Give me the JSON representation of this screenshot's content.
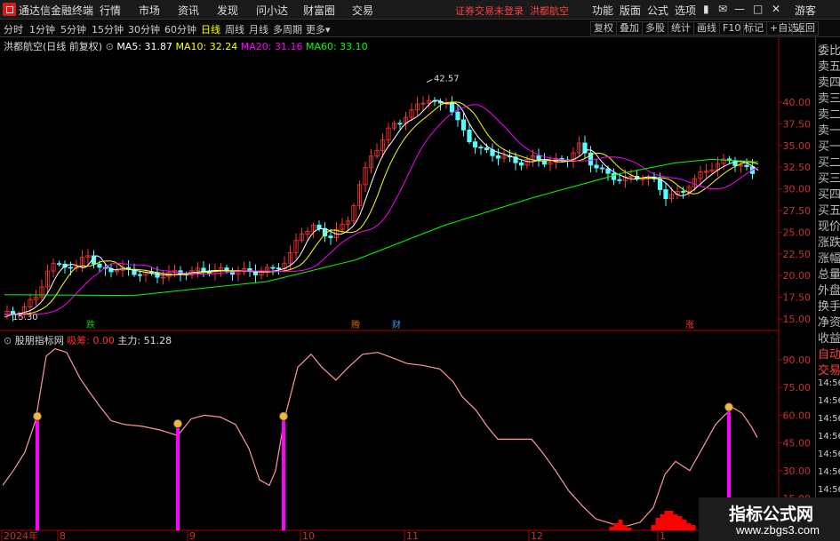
{
  "menubar": {
    "app_title": "通达信金融终端",
    "items": [
      "行情",
      "市场",
      "资讯",
      "发现",
      "问小达",
      "财富圈",
      "交易"
    ],
    "notice": "证券交易未登录",
    "stock": "洪都航空",
    "right_items": [
      "功能",
      "版面",
      "公式",
      "选项"
    ],
    "user": "游客"
  },
  "periodbar": {
    "periods": [
      "分时",
      "1分钟",
      "5分钟",
      "15分钟",
      "30分钟",
      "60分钟",
      "日线",
      "周线",
      "月线",
      "多周期",
      "更多"
    ],
    "active": "日线",
    "tools": [
      "复权",
      "叠加",
      "多股",
      "统计",
      "画线",
      "F10",
      "标记",
      "+自选",
      "返回"
    ]
  },
  "main_chart": {
    "title": "洪都航空(日线 前复权)",
    "ma": [
      {
        "label": "MA5: 31.87",
        "color": "#ffffff"
      },
      {
        "label": "MA10: 32.24",
        "color": "#ffff00"
      },
      {
        "label": "MA20: 31.16",
        "color": "#ff00ff"
      },
      {
        "label": "MA60: 33.10",
        "color": "#00ff00"
      }
    ],
    "high_label": "42.57",
    "low_label": "15.30",
    "y_ticks": [
      "40.00",
      "37.50",
      "35.00",
      "32.50",
      "30.00",
      "27.50",
      "25.00",
      "22.50",
      "20.00",
      "17.50",
      "15.00"
    ],
    "markers": [
      {
        "text": "跌",
        "color": "#00cc00"
      },
      {
        "text": "腾",
        "color": "#cc6600"
      },
      {
        "text": "财",
        "color": "#3399ff"
      },
      {
        "text": "涨",
        "color": "#ff3333"
      }
    ]
  },
  "indicator": {
    "title": "股朋指标网",
    "param1": "吸筹: 0.00",
    "param2": "主力: 51.28",
    "y_ticks": [
      "90.00",
      "75.00",
      "60.00",
      "45.00",
      "30.00",
      "15.00"
    ]
  },
  "x_axis": [
    "2024年",
    "8",
    "9",
    "10",
    "11",
    "12",
    "1"
  ],
  "right_panel": [
    "委比",
    "卖五",
    "卖四",
    "卖三",
    "卖二",
    "卖一",
    "买一",
    "买二",
    "买三",
    "买四",
    "买五",
    "现价",
    "涨跌",
    "涨幅",
    "总量",
    "外盘",
    "换手",
    "净资",
    "收益",
    "自动",
    "交易",
    "14:56",
    "14:56",
    "14:56",
    "14:56",
    "14:56",
    "14:56",
    "14:56"
  ],
  "watermark": {
    "line1": "指标公式网",
    "line2": "www.zbgs3.com"
  },
  "colors": {
    "up": "#ff3333",
    "down": "#54ffff",
    "axis": "#b00000",
    "grid": "#660000"
  }
}
